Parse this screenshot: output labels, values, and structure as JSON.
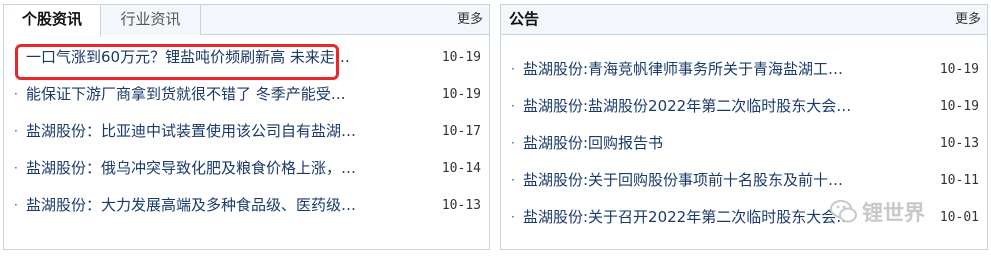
{
  "left_panel": {
    "tabs": [
      {
        "label": "个股资讯",
        "active": true
      },
      {
        "label": "行业资讯",
        "active": false
      }
    ],
    "more_label": "更多",
    "items": [
      {
        "title": "一口气涨到60万元？锂盐吨价频刷新高 未来走…",
        "date": "10-19"
      },
      {
        "title": "能保证下游厂商拿到货就很不错了 冬季产能受…",
        "date": "10-19"
      },
      {
        "title": "盐湖股份：比亚迪中试装置使用该公司自有盐湖…",
        "date": "10-17"
      },
      {
        "title": "盐湖股份：俄乌冲突导致化肥及粮食价格上涨，…",
        "date": "10-14"
      },
      {
        "title": "盐湖股份：大力发展高端及多种食品级、医药级…",
        "date": "10-13"
      }
    ]
  },
  "right_panel": {
    "title": "公告",
    "more_label": "更多",
    "items": [
      {
        "title": "盐湖股份:青海竞帆律师事务所关于青海盐湖工…",
        "date": "10-19"
      },
      {
        "title": "盐湖股份:盐湖股份2022年第二次临时股东大会…",
        "date": "10-19"
      },
      {
        "title": "盐湖股份:回购报告书",
        "date": "10-13"
      },
      {
        "title": "盐湖股份:关于回购股份事项前十名股东及前十…",
        "date": "10-11"
      },
      {
        "title": "盐湖股份:关于召开2022年第二次临时股东大会…",
        "date": "10-01"
      }
    ]
  },
  "watermark": {
    "text": "锂世界"
  },
  "colors": {
    "highlight": "#e8292b",
    "link": "#1a3a6b",
    "border": "#c6d3e3"
  }
}
